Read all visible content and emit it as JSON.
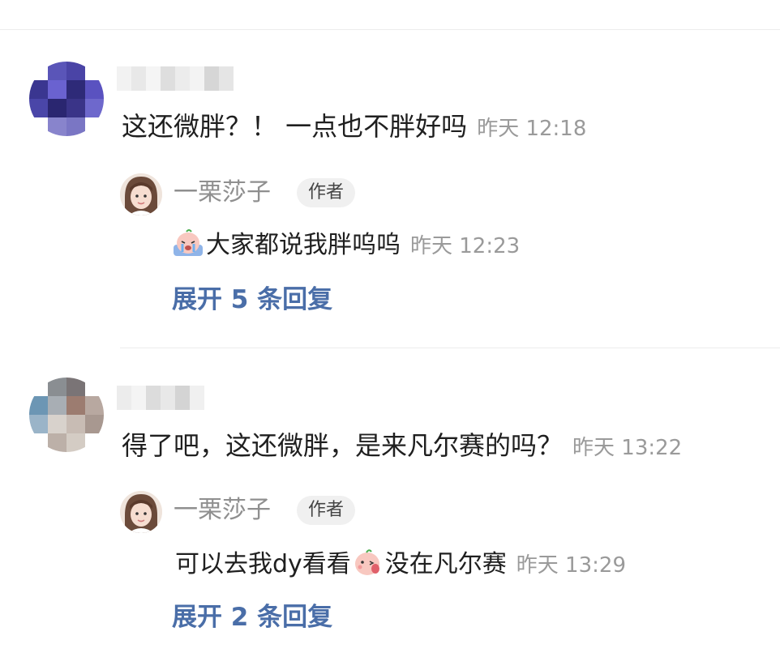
{
  "comments": [
    {
      "text": "这还微胖？！  一点也不胖好吗",
      "time": "昨天 12:18",
      "reply": {
        "author": "一栗莎子",
        "badge": "作者",
        "emoji": "crying-emoji",
        "text": "大家都说我胖呜呜",
        "time": "昨天 12:23"
      },
      "expand": "展开 5 条回复"
    },
    {
      "text": "得了吧，这还微胖，是来凡尔赛的吗？",
      "time": "昨天 13:22",
      "reply": {
        "author": "一栗莎子",
        "badge": "作者",
        "text_before": "可以去我dy看看",
        "emoji": "wink-kiss-emoji",
        "text_after": "没在凡尔赛",
        "time": "昨天 13:29"
      },
      "expand": "展开 2 条回复"
    }
  ],
  "colors": {
    "link": "#4a6ea8",
    "time": "#9a9a9a",
    "badge_bg": "#f0f0f0"
  }
}
